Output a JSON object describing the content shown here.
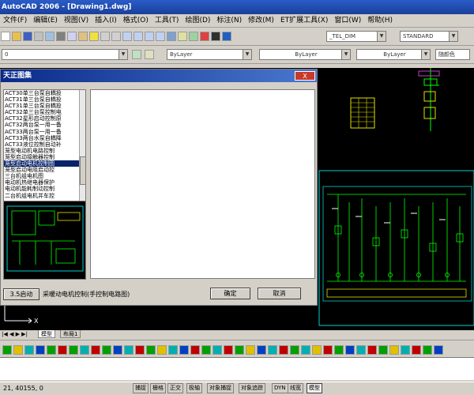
{
  "window": {
    "title": "AutoCAD 2006 - [Drawing1.dwg]"
  },
  "menu": [
    "文件(F)",
    "编辑(E)",
    "视图(V)",
    "插入(I)",
    "格式(O)",
    "工具(T)",
    "绘图(D)",
    "标注(N)",
    "修改(M)",
    "ET扩展工具(X)",
    "窗口(W)",
    "帮助(H)"
  ],
  "toolbar": {
    "text_style": "_TEL_DIM",
    "dim_style": "STANDARD",
    "layer": "0",
    "color": "ByLayer",
    "linetype": "ByLayer",
    "lineweight": "ByLayer",
    "plot_style": "随颜色"
  },
  "dialog": {
    "title": "天正图集",
    "close": "X",
    "list_items": [
      "ACT30单三台泵自耦投",
      "ACT31单三台泵自耦投",
      "ACT31单三台泵自耦投",
      "ACT32单三台泵控制电",
      "ACT32星形启动控制原",
      "ACT32两台泵一用一备",
      "ACT33两台泵一用一备",
      "ACT33两台水泵自耦降",
      "ACT33液位控制自动补",
      "笼型电动机电路控制",
      "笼型启动接触器控制",
      "笼型启动电机控制图",
      "笼型启动电阻启动控",
      "三台机组电机图",
      "电动机热继电器保护",
      "电动机能耗制动控制",
      "二台机组电机并车控"
    ],
    "selected_index": 11,
    "rename_button": "3.5启动",
    "path_text": "采暖动电机控制(手控制电路图)",
    "ok_button": "确定",
    "cancel_button": "取消"
  },
  "tabs": [
    "模型",
    "布局1"
  ],
  "status": {
    "coords": "21, 40155, 0",
    "buttons": [
      "捕捉",
      "栅格",
      "正交",
      "极轴",
      "对象捕捉",
      "对象追踪",
      "DYN",
      "线宽",
      "模型"
    ],
    "active": [
      8
    ]
  },
  "colors": {
    "titlebar": "#1a3f9a",
    "drawing_bg": "#000000",
    "cad_green": "#00ff00",
    "cad_cyan": "#00d0d0",
    "selection": "#0a246a"
  }
}
